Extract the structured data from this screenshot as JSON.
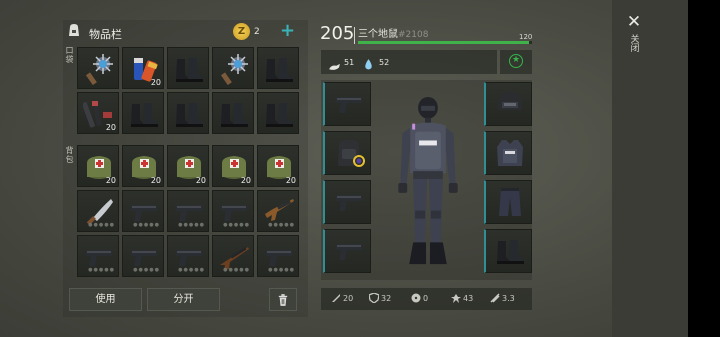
{
  "inventory": {
    "title": "物品栏",
    "coin_count": "2",
    "add_symbol": "+",
    "pocket_label": "口袋",
    "backpack_label": "背包",
    "use_label": "使用",
    "split_label": "分开"
  },
  "slots": [
    {
      "row": 0,
      "col": 0,
      "item": "spiked-club",
      "count": ""
    },
    {
      "row": 0,
      "col": 1,
      "item": "batteries",
      "count": "20"
    },
    {
      "row": 0,
      "col": 2,
      "item": "boots",
      "count": ""
    },
    {
      "row": 0,
      "col": 3,
      "item": "spiked-club",
      "count": ""
    },
    {
      "row": 0,
      "col": 4,
      "item": "boots",
      "count": ""
    },
    {
      "row": 1,
      "col": 0,
      "item": "tools",
      "count": "20"
    },
    {
      "row": 1,
      "col": 1,
      "item": "boots",
      "count": ""
    },
    {
      "row": 1,
      "col": 2,
      "item": "boots",
      "count": ""
    },
    {
      "row": 1,
      "col": 3,
      "item": "boots",
      "count": ""
    },
    {
      "row": 1,
      "col": 4,
      "item": "boots",
      "count": ""
    },
    {
      "row": 2,
      "col": 0,
      "item": "medkit-bag",
      "count": "20"
    },
    {
      "row": 2,
      "col": 1,
      "item": "medkit-bag",
      "count": "20"
    },
    {
      "row": 2,
      "col": 2,
      "item": "medkit-bag",
      "count": "20"
    },
    {
      "row": 2,
      "col": 3,
      "item": "medkit-bag",
      "count": "20"
    },
    {
      "row": 2,
      "col": 4,
      "item": "medkit-bag",
      "count": "20"
    },
    {
      "row": 3,
      "col": 0,
      "item": "machete",
      "count": ""
    },
    {
      "row": 3,
      "col": 1,
      "item": "pistol",
      "count": ""
    },
    {
      "row": 3,
      "col": 2,
      "item": "pistol",
      "count": ""
    },
    {
      "row": 3,
      "col": 3,
      "item": "pistol",
      "count": ""
    },
    {
      "row": 3,
      "col": 4,
      "item": "rifle",
      "count": ""
    },
    {
      "row": 4,
      "col": 0,
      "item": "pistol",
      "count": ""
    },
    {
      "row": 4,
      "col": 1,
      "item": "pistol",
      "count": ""
    },
    {
      "row": 4,
      "col": 2,
      "item": "pistol",
      "count": ""
    },
    {
      "row": 4,
      "col": 3,
      "item": "shotgun",
      "count": ""
    },
    {
      "row": 4,
      "col": 4,
      "item": "pistol",
      "count": ""
    }
  ],
  "player": {
    "level": "205",
    "name": "三个地鼠",
    "id": "#2108",
    "hp_max": "120",
    "hp_fraction": 0.98,
    "food": "51",
    "water": "52",
    "hp_color": "#3fb34a"
  },
  "equipment": {
    "left": [
      "pistol",
      "backpack",
      "pistol",
      "pistol"
    ],
    "right": [
      "helmet",
      "vest",
      "pants",
      "boots"
    ]
  },
  "stats": [
    {
      "icon": "damage-icon",
      "value": "20"
    },
    {
      "icon": "armor-icon",
      "value": "32"
    },
    {
      "icon": "radiation-icon",
      "value": "0"
    },
    {
      "icon": "speed-icon",
      "value": "43"
    },
    {
      "icon": "attack-speed-icon",
      "value": "3.3"
    }
  ],
  "close": {
    "label": "关闭",
    "symbol": "✕"
  }
}
